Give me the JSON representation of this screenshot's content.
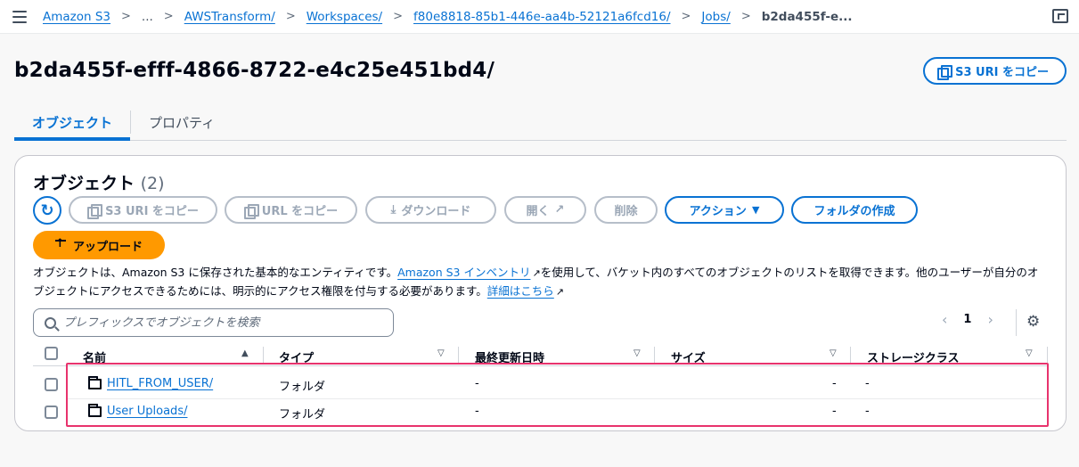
{
  "breadcrumbs": [
    {
      "label": "Amazon S3",
      "link": true
    },
    {
      "label": "...",
      "link": false
    },
    {
      "label": "AWSTransform/",
      "link": true
    },
    {
      "label": "Workspaces/",
      "link": true
    },
    {
      "label": "f80e8818-85b1-446e-aa4b-52121a6fcd16/",
      "link": true
    },
    {
      "label": "Jobs/",
      "link": true
    },
    {
      "label": "b2da455f-e...",
      "link": false
    }
  ],
  "page_title": "b2da455f-efff-4866-8722-e4c25e451bd4/",
  "copy_uri_button": "S3 URI をコピー",
  "tabs": [
    {
      "label": "オブジェクト",
      "active": true
    },
    {
      "label": "プロパティ",
      "active": false
    }
  ],
  "objects": {
    "title": "オブジェクト",
    "count": "(2)",
    "toolbar": {
      "copy_s3_uri": "S3 URI をコピー",
      "copy_url": "URL をコピー",
      "download": "ダウンロード",
      "open": "開く",
      "delete": "削除",
      "actions": "アクション",
      "create_folder": "フォルダの作成",
      "upload": "アップロード"
    },
    "description": {
      "part1": "オブジェクトは、Amazon S3 に保存された基本的なエンティティです。",
      "inventory_link": "Amazon S3 インベントリ",
      "part2": "を使用して、バケット内のすべてのオブジェクトのリストを取得できます。他のユーザーが自分のオブジェクトにアクセスできるためには、明示的にアクセス権限を付与する必要があります。",
      "learn_more": "詳細はこちら"
    },
    "search_placeholder": "プレフィックスでオブジェクトを検索",
    "page_number": "1",
    "columns": [
      "名前",
      "タイプ",
      "最終更新日時",
      "サイズ",
      "ストレージクラス"
    ],
    "rows": [
      {
        "name": "HITL_FROM_USER/",
        "type": "フォルダ",
        "modified": "-",
        "size": "-",
        "storage": "-"
      },
      {
        "name": "User Uploads/",
        "type": "フォルダ",
        "modified": "-",
        "size": "-",
        "storage": "-"
      }
    ]
  },
  "colors": {
    "accent": "#0972d3",
    "upload": "#ff9900",
    "highlight": "#e8336d"
  }
}
